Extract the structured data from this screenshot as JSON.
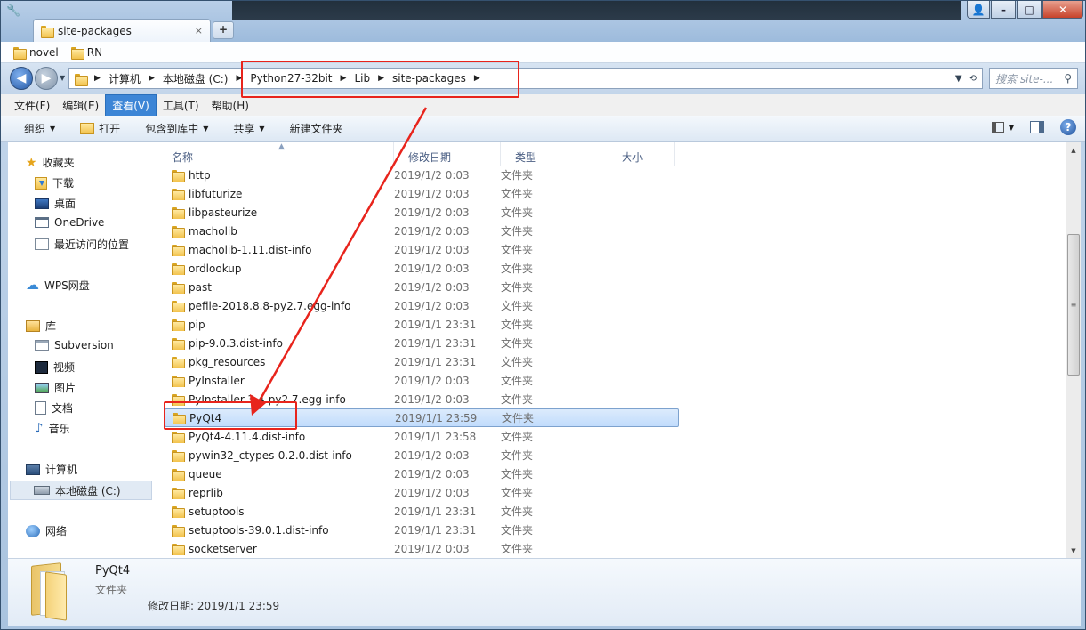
{
  "window": {
    "tab_title": "site-packages",
    "tab_close": "×",
    "new_tab": "+",
    "controls": {
      "user": "👤",
      "minimize": "–",
      "maximize": "□",
      "close": "✕"
    }
  },
  "favorites": [
    {
      "label": "novel",
      "icon": "folder-icon"
    },
    {
      "label": "RN",
      "icon": "folder-icon"
    }
  ],
  "address": {
    "crumbs": [
      "计算机",
      "本地磁盘 (C:)",
      "Python27-32bit",
      "Lib",
      "site-packages"
    ],
    "search_placeholder": "搜索 site-..."
  },
  "menu": [
    {
      "label": "文件(F)",
      "active": false
    },
    {
      "label": "编辑(E)",
      "active": false
    },
    {
      "label": "查看(V)",
      "active": true
    },
    {
      "label": "工具(T)",
      "active": false
    },
    {
      "label": "帮助(H)",
      "active": false
    }
  ],
  "commands": {
    "organize": "组织",
    "open": "打开",
    "include_in_library": "包含到库中",
    "share": "共享",
    "new_folder": "新建文件夹",
    "help": "?"
  },
  "nav": {
    "favorites": "收藏夹",
    "downloads": "下载",
    "desktop": "桌面",
    "onedrive": "OneDrive",
    "recent": "最近访问的位置",
    "wps": "WPS网盘",
    "libraries": "库",
    "subversion": "Subversion",
    "videos": "视频",
    "pictures": "图片",
    "documents": "文档",
    "music": "音乐",
    "computer": "计算机",
    "local_disk": "本地磁盘 (C:)",
    "network": "网络"
  },
  "columns": {
    "name": "名称",
    "date": "修改日期",
    "type": "类型",
    "size": "大小"
  },
  "files": [
    {
      "name": "http",
      "date": "2019/1/2 0:03",
      "type": "文件夹"
    },
    {
      "name": "libfuturize",
      "date": "2019/1/2 0:03",
      "type": "文件夹"
    },
    {
      "name": "libpasteurize",
      "date": "2019/1/2 0:03",
      "type": "文件夹"
    },
    {
      "name": "macholib",
      "date": "2019/1/2 0:03",
      "type": "文件夹"
    },
    {
      "name": "macholib-1.11.dist-info",
      "date": "2019/1/2 0:03",
      "type": "文件夹"
    },
    {
      "name": "ordlookup",
      "date": "2019/1/2 0:03",
      "type": "文件夹"
    },
    {
      "name": "past",
      "date": "2019/1/2 0:03",
      "type": "文件夹"
    },
    {
      "name": "pefile-2018.8.8-py2.7.egg-info",
      "date": "2019/1/2 0:03",
      "type": "文件夹"
    },
    {
      "name": "pip",
      "date": "2019/1/1 23:31",
      "type": "文件夹"
    },
    {
      "name": "pip-9.0.3.dist-info",
      "date": "2019/1/1 23:31",
      "type": "文件夹"
    },
    {
      "name": "pkg_resources",
      "date": "2019/1/1 23:31",
      "type": "文件夹"
    },
    {
      "name": "PyInstaller",
      "date": "2019/1/2 0:03",
      "type": "文件夹"
    },
    {
      "name": "PyInstaller-3.4-py2.7.egg-info",
      "date": "2019/1/2 0:03",
      "type": "文件夹"
    },
    {
      "name": "PyQt4",
      "date": "2019/1/1 23:59",
      "type": "文件夹",
      "selected": true
    },
    {
      "name": "PyQt4-4.11.4.dist-info",
      "date": "2019/1/1 23:58",
      "type": "文件夹"
    },
    {
      "name": "pywin32_ctypes-0.2.0.dist-info",
      "date": "2019/1/2 0:03",
      "type": "文件夹"
    },
    {
      "name": "queue",
      "date": "2019/1/2 0:03",
      "type": "文件夹"
    },
    {
      "name": "reprlib",
      "date": "2019/1/2 0:03",
      "type": "文件夹"
    },
    {
      "name": "setuptools",
      "date": "2019/1/1 23:31",
      "type": "文件夹"
    },
    {
      "name": "setuptools-39.0.1.dist-info",
      "date": "2019/1/1 23:31",
      "type": "文件夹"
    },
    {
      "name": "socketserver",
      "date": "2019/1/2 0:03",
      "type": "文件夹"
    }
  ],
  "details": {
    "name": "PyQt4",
    "type": "文件夹",
    "modified_label": "修改日期:",
    "modified_value": "2019/1/1 23:59"
  },
  "colors": {
    "annotation": "#e8241c",
    "selection": "#c1dcfc",
    "menu_active": "#3c85d6"
  }
}
